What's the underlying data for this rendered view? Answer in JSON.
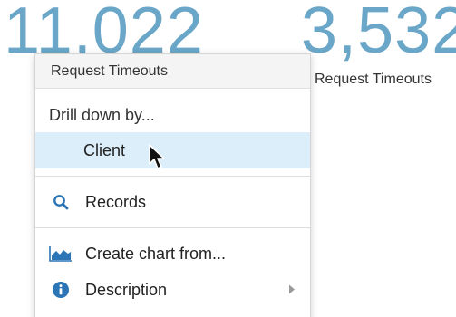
{
  "metrics": [
    {
      "value": "11,022"
    },
    {
      "value": "3,532",
      "label": "Request Timeouts"
    }
  ],
  "context_menu": {
    "header": "Request Timeouts",
    "drill_down_title": "Drill down by...",
    "items": {
      "client": "Client",
      "records": "Records",
      "create_chart": "Create chart from...",
      "description": "Description"
    }
  },
  "colors": {
    "metric_blue": "#6aa6c8",
    "hover_bg": "#dbeefa",
    "icon_blue": "#2b74b6"
  },
  "icons": {
    "records": "search-icon",
    "create_chart": "area-chart-icon",
    "description": "info-icon",
    "submenu": "chevron-right-icon",
    "pointer": "mouse-cursor-icon"
  }
}
